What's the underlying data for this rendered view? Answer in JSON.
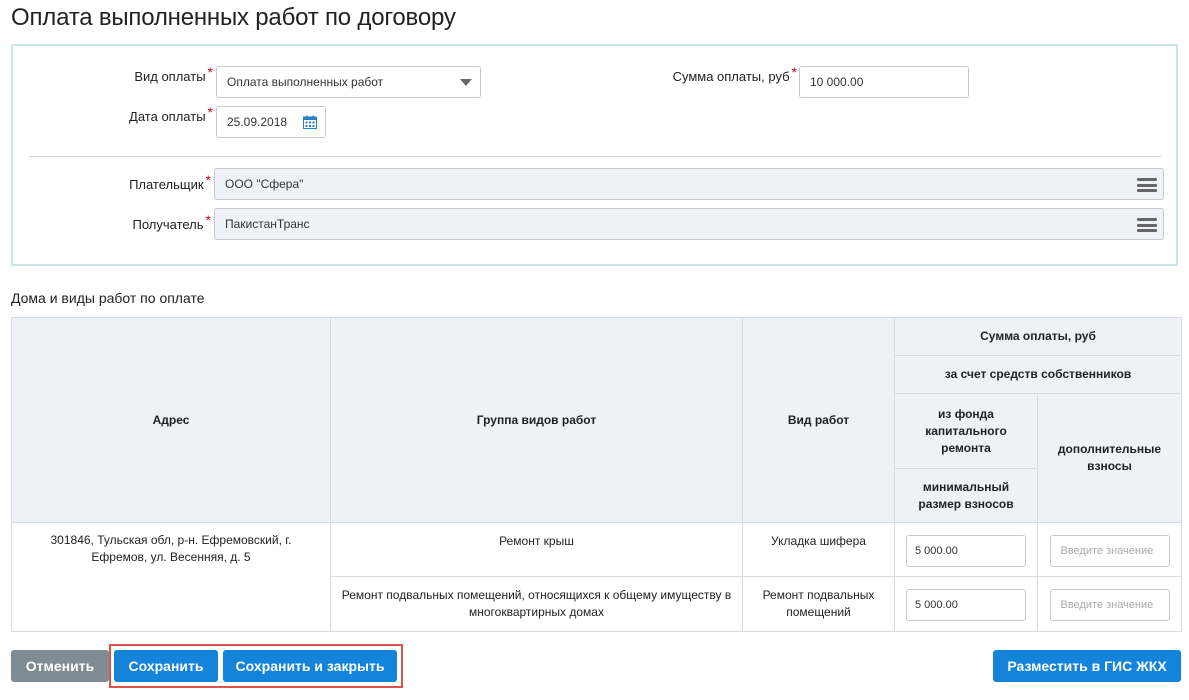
{
  "page": {
    "title": "Оплата выполненных работ по договору"
  },
  "form": {
    "payment_type": {
      "label": "Вид оплаты",
      "value": "Оплата выполненных работ"
    },
    "payment_date": {
      "label": "Дата оплаты",
      "value": "25.09.2018"
    },
    "payment_sum": {
      "label": "Сумма оплаты, руб",
      "value": "10 000.00"
    },
    "payer": {
      "label": "Плательщик",
      "value": "ООО \"Сфера\""
    },
    "recipient": {
      "label": "Получатель",
      "value": "ПакистанТранс"
    },
    "required_mark": "*"
  },
  "works_section": {
    "title": "Дома и виды работ по оплате",
    "headers": {
      "address": "Адрес",
      "group": "Группа видов работ",
      "work_type": "Вид работ",
      "sum": "Сумма оплаты, руб",
      "owners_funds": "за счет средств собственников",
      "cap_fund": "из фонда капитального ремонта",
      "additional": "дополнительные взносы",
      "min_contrib": "минимальный размер взносов"
    },
    "rows": [
      {
        "address": "301846, Тульская обл, р-н. Ефремовский, г. Ефремов, ул. Весенняя, д. 5",
        "group": "Ремонт крыш",
        "work_type": "Укладка шифера",
        "min_contrib": "5 000.00",
        "additional_placeholder": "Введите значение"
      },
      {
        "group": "Ремонт подвальных помещений, относящихся к общему имуществу в многоквартирных домах",
        "work_type": "Ремонт подвальных помещений",
        "min_contrib": "5 000.00",
        "additional_placeholder": "Введите значение"
      }
    ]
  },
  "actions": {
    "cancel": "Отменить",
    "save": "Сохранить",
    "save_close": "Сохранить и закрыть",
    "publish": "Разместить в ГИС ЖКХ"
  },
  "colors": {
    "primary": "#1384d9",
    "cancel": "#7f8c93",
    "required": "#d0021b",
    "highlight": "#d9534f"
  }
}
